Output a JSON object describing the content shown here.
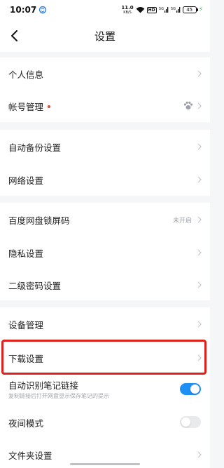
{
  "status_bar": {
    "time": "10:07",
    "net_speed": "11.0",
    "net_unit": "KB/S",
    "hd_label": "HD",
    "signal_a": "5G",
    "signal_b": "5G",
    "battery": "45"
  },
  "nav": {
    "title": "设置"
  },
  "sections": {
    "account": {
      "personal_info": "个人信息",
      "account_management": "帐号管理"
    },
    "network": {
      "auto_backup": "自动备份设置",
      "network_settings": "网络设置"
    },
    "security": {
      "lock_screen": "百度网盘锁屏码",
      "lock_screen_status": "未开启",
      "privacy": "隐私设置",
      "secondary_password": "二级密码设置"
    },
    "general": {
      "device_management": "设备管理",
      "download_settings": "下载设置",
      "auto_note_link": "自动识别笔记链接",
      "auto_note_link_desc": "复制链接后打开网盘显示保存笔记的提示",
      "auto_note_link_on": true,
      "night_mode": "夜间模式",
      "night_mode_on": false,
      "folder_settings": "文件夹设置"
    }
  },
  "colors": {
    "accent": "#1e8ff5",
    "highlight": "#e0211b",
    "badge": "#e8463d"
  }
}
